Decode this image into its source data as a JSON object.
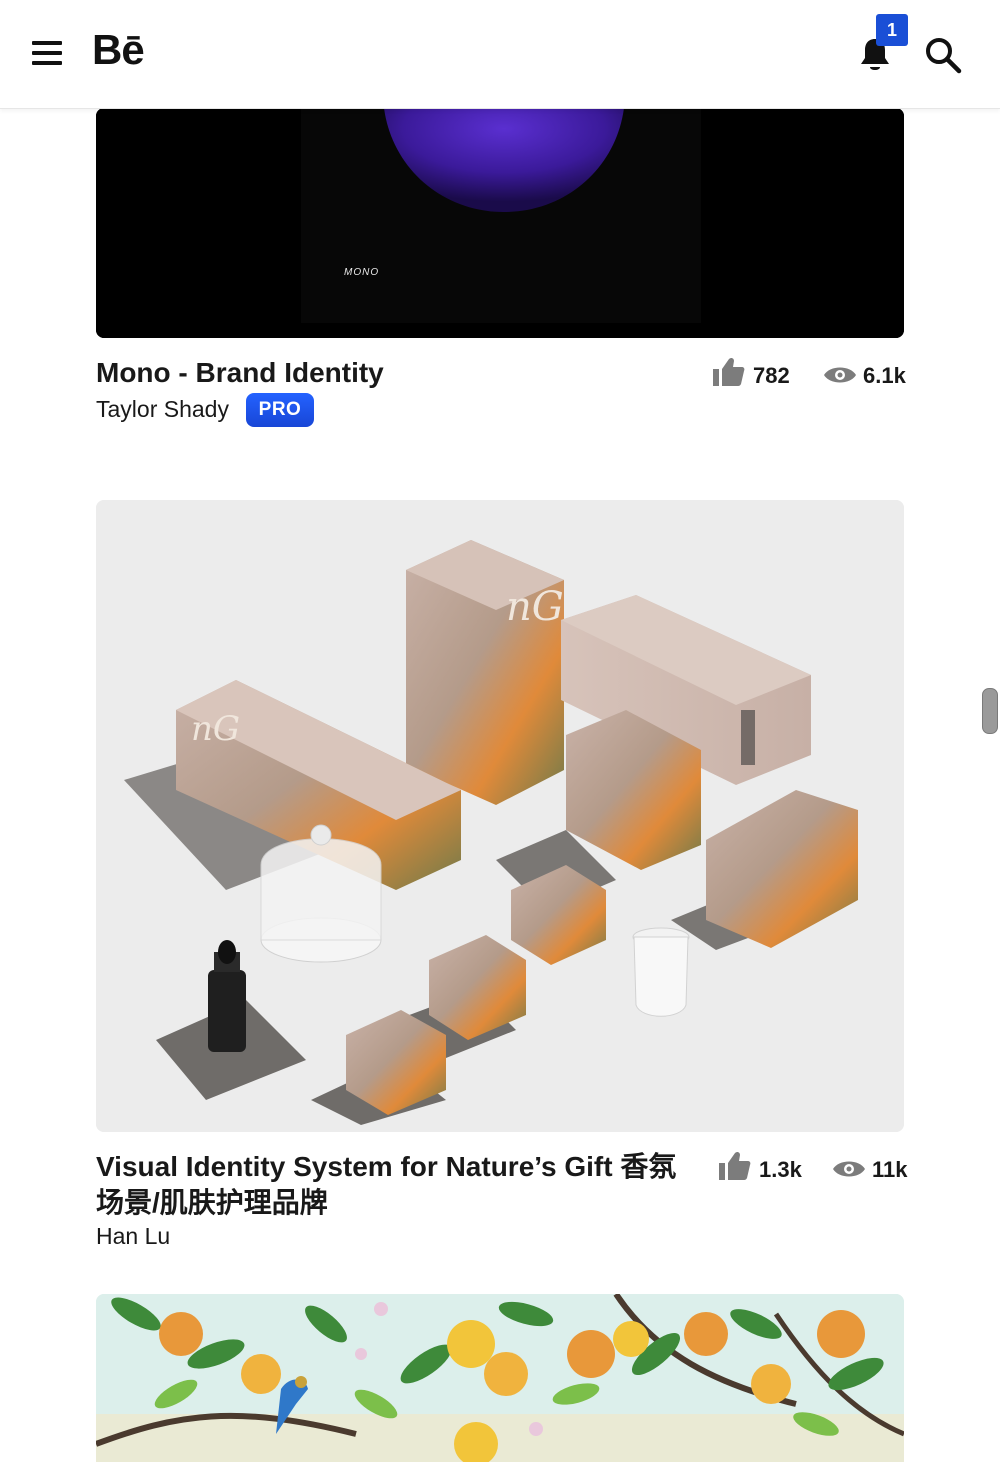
{
  "header": {
    "logo": "Bē",
    "notification_count": "1",
    "icons": [
      "menu-icon",
      "bell-icon",
      "search-icon"
    ]
  },
  "projects": [
    {
      "title": "Mono - Brand Identity",
      "owner": "Taylor Shady",
      "badge": "PRO",
      "appreciations": "782",
      "views": "6.1k",
      "thumb_wordmark": "MONO"
    },
    {
      "title_line1": "Visual Identity System for Nature’s Gift 香氛",
      "title_line2": "场景/肌肤护理品牌",
      "owner": "Han Lu",
      "appreciations": "1.3k",
      "views": "11k"
    },
    {
      "thumb": "illustration-citrus-branches"
    }
  ],
  "colors": {
    "accent": "#1a4fd6",
    "text": "#191919",
    "stat_icon": "#7c7c7c"
  }
}
